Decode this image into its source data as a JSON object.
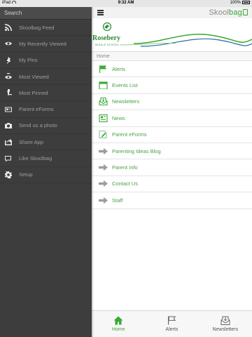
{
  "status_bar": {
    "carrier": "iPad",
    "time": "9:32 AM",
    "battery": "100%"
  },
  "sidebar": {
    "search_label": "Search",
    "items": [
      {
        "label": "Skoolbag Feed",
        "icon": "rss-icon"
      },
      {
        "label": "My Recently Viewed",
        "icon": "eye-icon"
      },
      {
        "label": "My Pins",
        "icon": "pin-icon"
      },
      {
        "label": "Most Viewed",
        "icon": "eye-plus-icon"
      },
      {
        "label": "Most Pinned",
        "icon": "pin-plus-icon"
      },
      {
        "label": "Parent eForms",
        "icon": "id-card-icon"
      },
      {
        "label": "Send us a photo",
        "icon": "camera-icon"
      },
      {
        "label": "Share App",
        "icon": "share-icon"
      },
      {
        "label": "Like Skoolbag",
        "icon": "like-icon"
      },
      {
        "label": "Setup",
        "icon": "gear-icon"
      }
    ]
  },
  "topbar": {
    "brand_left": "Skool",
    "brand_right": "bag"
  },
  "banner": {
    "school_name": "Rosebery",
    "school_sub": "MIDDLE SCHOOL"
  },
  "breadcrumb": "Home",
  "menu": {
    "items": [
      {
        "label": "Alerts",
        "icon": "flag-icon"
      },
      {
        "label": "Events List",
        "icon": "calendar-icon"
      },
      {
        "label": "Newsletters",
        "icon": "newsletter-icon"
      },
      {
        "label": "News",
        "icon": "news-icon"
      },
      {
        "label": "Parent eForms",
        "icon": "eform-icon"
      },
      {
        "label": "Parenting Ideas Blog",
        "icon": "arrow-icon"
      },
      {
        "label": "Parent Info",
        "icon": "arrow-icon"
      },
      {
        "label": "Contact Us",
        "icon": "arrow-icon"
      },
      {
        "label": "Staff",
        "icon": "arrow-icon"
      }
    ]
  },
  "tabs": [
    {
      "label": "Home",
      "icon": "home-icon",
      "active": true
    },
    {
      "label": "Alerts",
      "icon": "flag-icon",
      "active": false
    },
    {
      "label": "Newsletters",
      "icon": "newsletter-icon",
      "active": false
    }
  ],
  "colors": {
    "accent": "#3aa935",
    "sidebar_bg": "#3d3d3d",
    "link": "#4aa146"
  }
}
